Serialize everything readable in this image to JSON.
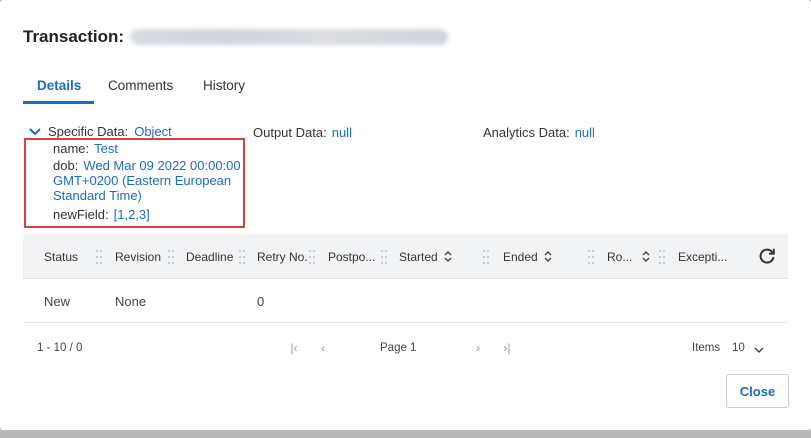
{
  "dialog": {
    "title_label": "Transaction:",
    "tabs": [
      {
        "label": "Details",
        "active": true
      },
      {
        "label": "Comments",
        "active": false
      },
      {
        "label": "History",
        "active": false
      }
    ],
    "specific_data": {
      "label": "Specific Data:",
      "value": "Object"
    },
    "output_data": {
      "label": "Output Data:",
      "value": "null"
    },
    "analytics_data": {
      "label": "Analytics Data:",
      "value": "null"
    },
    "object_fields": {
      "name": {
        "label": "name:",
        "value": "Test"
      },
      "dob": {
        "label": "dob:",
        "value": "Wed Mar 09 2022 00:00:00 GMT+0200 (Eastern European Standard Time)"
      },
      "newField": {
        "label": "newField:",
        "value": "[1,2,3]"
      }
    },
    "grid": {
      "columns": [
        "Status",
        "Revision",
        "Deadline",
        "Retry No.",
        "Postpo...",
        "Started",
        "Ended",
        "Ro...",
        "Excepti..."
      ],
      "rows": [
        {
          "status": "New",
          "revision": "None",
          "retry": "0"
        }
      ]
    },
    "pager": {
      "range": "1 - 10 / 0",
      "page_label": "Page 1",
      "items_label": "Items",
      "items_value": "10"
    },
    "close_label": "Close"
  },
  "colors": {
    "accent": "#1a6dbd",
    "highlight_box": "#d94040",
    "header_bg": "#f2f3f5"
  },
  "icons": [
    "chevron-down-icon",
    "drag-handle-icon",
    "sort-icon",
    "refresh-icon",
    "first-page-icon",
    "prev-page-icon",
    "next-page-icon",
    "last-page-icon"
  ]
}
